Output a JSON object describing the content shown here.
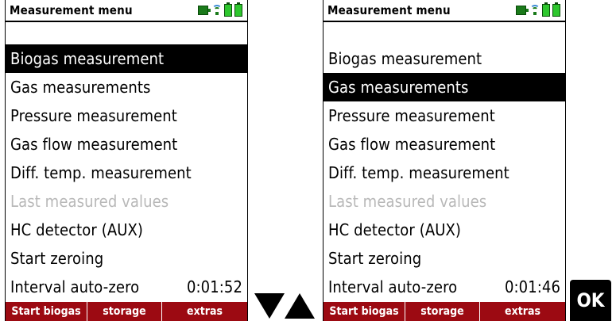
{
  "screens": [
    {
      "title": "Measurement menu",
      "items": [
        {
          "label": "Biogas measurement",
          "value": "",
          "state": "selected"
        },
        {
          "label": "Gas measurements",
          "value": "",
          "state": "normal"
        },
        {
          "label": "Pressure measurement",
          "value": "",
          "state": "normal"
        },
        {
          "label": "Gas flow measurement",
          "value": "",
          "state": "normal"
        },
        {
          "label": "Diff. temp. measurement",
          "value": "",
          "state": "normal"
        },
        {
          "label": "Last measured values",
          "value": "",
          "state": "disabled"
        },
        {
          "label": "HC detector (AUX)",
          "value": "",
          "state": "normal"
        },
        {
          "label": "Start zeroing",
          "value": "",
          "state": "normal"
        },
        {
          "label": "Interval auto-zero",
          "value": "0:01:52",
          "state": "normal"
        }
      ],
      "softkeys": [
        "Start biogas",
        "storage",
        "extras"
      ]
    },
    {
      "title": "Measurement menu",
      "items": [
        {
          "label": "Biogas measurement",
          "value": "",
          "state": "normal"
        },
        {
          "label": "Gas measurements",
          "value": "",
          "state": "selected"
        },
        {
          "label": "Pressure measurement",
          "value": "",
          "state": "normal"
        },
        {
          "label": "Gas flow measurement",
          "value": "",
          "state": "normal"
        },
        {
          "label": "Diff. temp. measurement",
          "value": "",
          "state": "normal"
        },
        {
          "label": "Last measured values",
          "value": "",
          "state": "disabled"
        },
        {
          "label": "HC detector (AUX)",
          "value": "",
          "state": "normal"
        },
        {
          "label": "Start zeroing",
          "value": "",
          "state": "normal"
        },
        {
          "label": "Interval auto-zero",
          "value": "0:01:46",
          "state": "normal"
        }
      ],
      "softkeys": [
        "Start biogas",
        "storage",
        "extras"
      ]
    }
  ],
  "status_icons": [
    "plug-icon",
    "wireless-icon",
    "battery-icon",
    "battery-icon"
  ],
  "nav_keys": {
    "down_icon": "arrow-down-icon",
    "up_icon": "arrow-up-icon"
  },
  "ok_key_label": "OK",
  "colors": {
    "softkey_bar": "#9c0a12",
    "selection": "#000000",
    "disabled_text": "#b8b8b8",
    "icon_green": "#2ec72e"
  }
}
